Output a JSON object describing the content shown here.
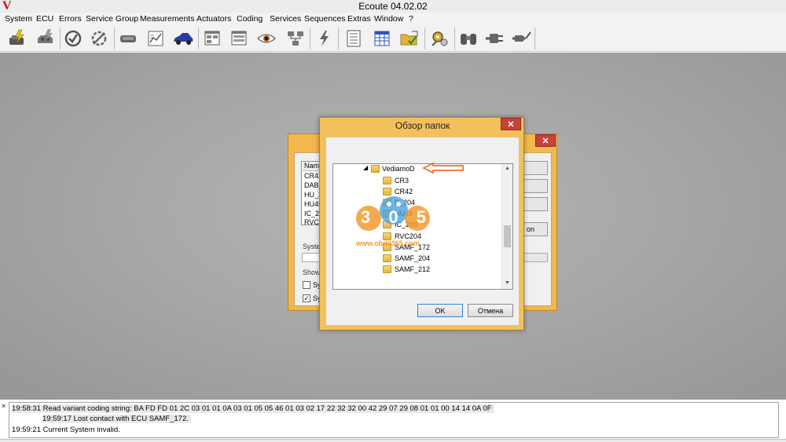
{
  "window": {
    "title": "Ecoute 04.02.02",
    "app_icon": "V"
  },
  "menu": [
    "System",
    "ECU",
    "Errors",
    "Service Group",
    "Measurements",
    "Actuators",
    "Coding",
    "Services",
    "Sequences",
    "Extras",
    "Window",
    "?"
  ],
  "toolbar": {
    "icons": [
      "tool-lightning-icon",
      "engine-lightning-icon",
      "check-circle-icon",
      "slash-circle-icon",
      "connector-icon",
      "chart-icon",
      "car-icon",
      "window-grid-icon",
      "eye-icon",
      "network-icon",
      "lightning-icon",
      "list-icon",
      "table-icon",
      "folder-check-icon",
      "gears-icon",
      "binoculars-icon",
      "plug-icon",
      "socket-icon"
    ]
  },
  "back_window": {
    "list_header": "Nam",
    "list_items": [
      "CR42",
      "DAB_",
      "HU_2",
      "HU45",
      "IC_20",
      "RVC2"
    ],
    "labels": [
      "System",
      "Show",
      "Sy",
      "Sy"
    ],
    "button_fragment": "on"
  },
  "dialog": {
    "title": "Обзор папок",
    "close_label": "✕",
    "tree": [
      {
        "label": "VediamoD",
        "expanded": true,
        "level": 0
      },
      {
        "label": "CR3",
        "level": 1
      },
      {
        "label": "CR42",
        "level": 1
      },
      {
        "label": "B_204",
        "level": 1
      },
      {
        "label": "HU45",
        "level": 1
      },
      {
        "label": "IC_204",
        "level": 1
      },
      {
        "label": "RVC204",
        "level": 1
      },
      {
        "label": "SAMF_172",
        "level": 1
      },
      {
        "label": "SAMF_204",
        "level": 1
      },
      {
        "label": "SAMF_212",
        "level": 1
      }
    ],
    "ok_label": "OK",
    "cancel_label": "Отмена"
  },
  "watermark": {
    "logo_text": "305",
    "url": "www.obdii365.com"
  },
  "log": [
    "19:58:31 Read variant coding string: BA FD FD 01 2C 03 01 01 0A 03 01 05 05 46 01 03 02 17 22 32 32 00 42 29 07 29 08 01 01 00 14 14 0A 0F",
    "19:59:17 Lost contact with ECU SAMF_172.",
    "19:59:21 Current System invalid."
  ],
  "colors": {
    "dialog_frame": "#f3c15b",
    "close_button": "#c7423a",
    "workspace": "#a8a8a8",
    "annotation_arrow": "#e8732a"
  }
}
